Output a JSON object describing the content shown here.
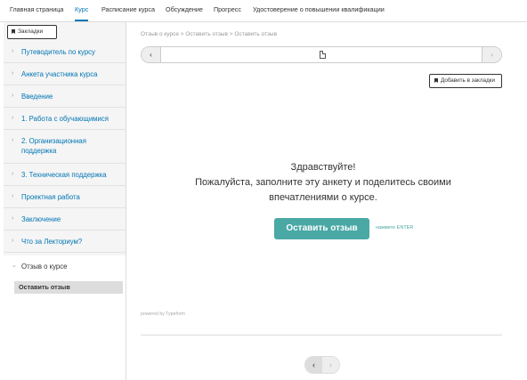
{
  "topnav": {
    "tabs": [
      {
        "label": "Главная страница"
      },
      {
        "label": "Курс"
      },
      {
        "label": "Расписание курса"
      },
      {
        "label": "Обсуждение"
      },
      {
        "label": "Прогресс"
      },
      {
        "label": "Удостоверение о повышении квалификации"
      }
    ]
  },
  "sidebar": {
    "bookmarks_label": "Закладки",
    "items": [
      {
        "label": "Путеводитель по курсу"
      },
      {
        "label": "Анкета участника курса"
      },
      {
        "label": "Введение"
      },
      {
        "label": "1. Работа с обучающимися"
      },
      {
        "label": "2. Организационная поддержка"
      },
      {
        "label": "3. Техническая поддержка"
      },
      {
        "label": "Проектная работа"
      },
      {
        "label": "Заключение"
      },
      {
        "label": "Что за Лекториум?"
      },
      {
        "label": "Отзыв о курсе"
      }
    ],
    "active_subitem": "Оставить отзыв"
  },
  "main": {
    "breadcrumb": "Отзыв о курсе > Оставить отзыв > Оставить отзыв",
    "add_bookmark_label": "Добавить в закладки",
    "greeting_line1": "Здравствуйте!",
    "greeting_line2": "Пожалуйста, заполните эту анкету и поделитесь своими",
    "greeting_line3": "впечатлениями о курсе.",
    "cta_label": "Оставить отзыв",
    "cta_hint": "нажмите ENTER",
    "powered_by": "powered by Typeform"
  },
  "colors": {
    "accent": "#0075b4",
    "button": "#4aa8a5"
  }
}
